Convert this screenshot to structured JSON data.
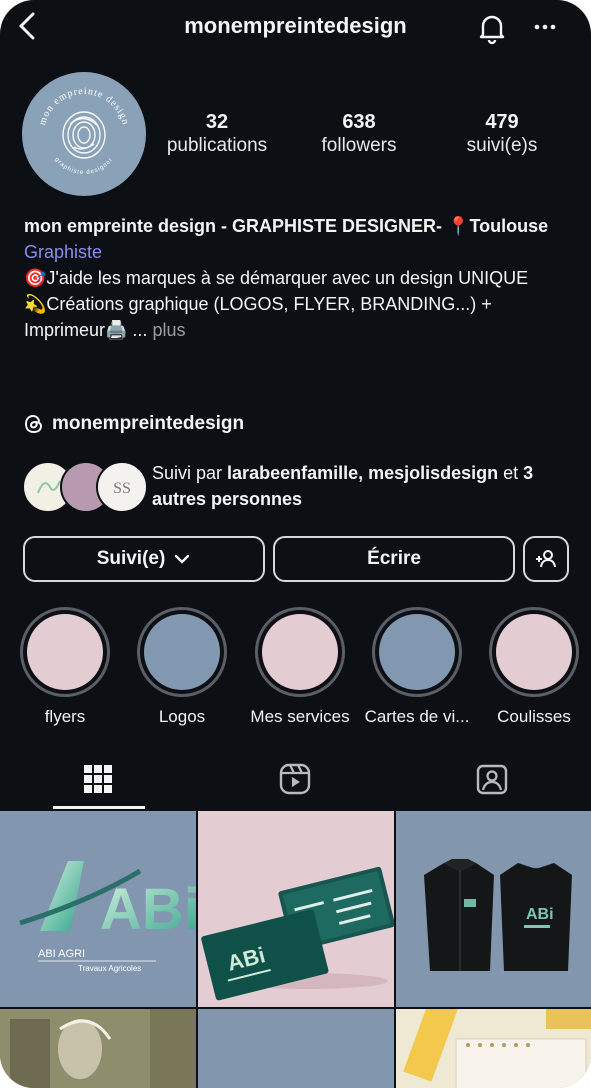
{
  "header": {
    "username": "monempreintedesign"
  },
  "profile": {
    "avatar_text_top": "mon empreinte design",
    "avatar_text_bottom": "graphiste designer",
    "stats": [
      {
        "number": "32",
        "label": "publications"
      },
      {
        "number": "638",
        "label": "followers"
      },
      {
        "number": "479",
        "label": "suivi(e)s"
      }
    ]
  },
  "bio": {
    "name": "mon empreinte design - GRAPHISTE DESIGNER- 📍Toulouse",
    "category": "Graphiste",
    "line1": "🎯J'aide les marques à se démarquer avec un design UNIQUE",
    "line2": "💫Créations graphique (LOGOS, FLYER, BRANDING...) + Imprimeur🖨️ ...",
    "more": "plus"
  },
  "threads": {
    "handle": "monempreintedesign"
  },
  "followed_by": {
    "prefix": "Suivi par ",
    "names": "larabeenfamille, mesjolisdesign",
    "middle": " et ",
    "others": "3 autres personnes"
  },
  "buttons": {
    "following": "Suivi(e)",
    "message": "Écrire"
  },
  "highlights": [
    {
      "label": "flyers",
      "color": "#e3ccd2"
    },
    {
      "label": "Logos",
      "color": "#8297b0"
    },
    {
      "label": "Mes services",
      "color": "#e3ccd2"
    },
    {
      "label": "Cartes de vi...",
      "color": "#8297b0"
    },
    {
      "label": "Coulisses",
      "color": "#e3ccd2"
    }
  ],
  "posts": {
    "abi_name": "ABI AGRI",
    "abi_sub": "Travaux Agricoles",
    "abi_logo": "ABi"
  },
  "colors": {
    "background": "#0c0f14",
    "accent_link": "#8b8cf0",
    "pink": "#e3ccd2",
    "blue": "#8297b0"
  }
}
